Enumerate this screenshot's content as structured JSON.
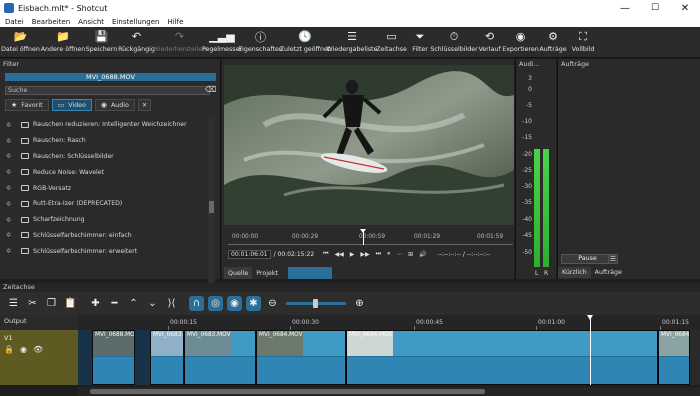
{
  "window": {
    "title": "Eisbach.mlt* - Shotcut",
    "min": "—",
    "max": "☐",
    "close": "✕"
  },
  "menu": [
    "Datei",
    "Bearbeiten",
    "Ansicht",
    "Einstellungen",
    "Hilfe"
  ],
  "toolbar": [
    {
      "label": "Datei öffnen",
      "icon": "folder-icon",
      "glyph": "📂",
      "enabled": true
    },
    {
      "label": "Andere öffnen",
      "icon": "open-other-icon",
      "glyph": "📁",
      "enabled": true
    },
    {
      "label": "Speichern",
      "icon": "save-icon",
      "glyph": "💾",
      "enabled": true
    },
    {
      "label": "Rückgängig",
      "icon": "undo-icon",
      "glyph": "↶",
      "enabled": true
    },
    {
      "label": "Wiederherstellen",
      "icon": "redo-icon",
      "glyph": "↷",
      "enabled": false
    },
    {
      "label": "Pegelmesser",
      "icon": "meter-icon",
      "glyph": "▁▃▅",
      "enabled": true
    },
    {
      "label": "Eigenschaften",
      "icon": "info-icon",
      "glyph": "ⓘ",
      "enabled": true
    },
    {
      "label": "Zuletzt geöffnet",
      "icon": "clock-icon",
      "glyph": "🕓",
      "enabled": true
    },
    {
      "label": "Wiedergabeliste",
      "icon": "playlist-icon",
      "glyph": "☰",
      "enabled": true
    },
    {
      "label": "Zeitachse",
      "icon": "timeline-icon",
      "glyph": "▭",
      "enabled": true
    },
    {
      "label": "Filter",
      "icon": "filter-icon",
      "glyph": "⏷",
      "enabled": true
    },
    {
      "label": "Schlüsselbilder",
      "icon": "stopwatch-icon",
      "glyph": "⏱",
      "enabled": true
    },
    {
      "label": "Verlauf",
      "icon": "history-icon",
      "glyph": "⟲",
      "enabled": true
    },
    {
      "label": "Exportieren",
      "icon": "export-icon",
      "glyph": "◉",
      "enabled": true
    },
    {
      "label": "Aufträge",
      "icon": "jobs-icon",
      "glyph": "⚙",
      "enabled": true
    },
    {
      "label": "Vollbild",
      "icon": "fullscreen-icon",
      "glyph": "⛶",
      "enabled": true
    }
  ],
  "filters": {
    "header": "Filter",
    "clip_name": "MVI_0688.MOV",
    "search_placeholder": "Suche",
    "tabs": [
      {
        "label": "Favorit",
        "icon": "star-icon",
        "glyph": "★",
        "active": false
      },
      {
        "label": "Video",
        "icon": "monitor-icon",
        "glyph": "▭",
        "active": true
      },
      {
        "label": "Audio",
        "icon": "speaker-icon",
        "glyph": "◉",
        "active": false
      }
    ],
    "close_glyph": "✕",
    "items": [
      "Rauschen reduzieren: Intelligenter Weichzeichner",
      "Rauschen: Rasch",
      "Rauschen: Schlüsselbilder",
      "Reduce Noise: Wavelet",
      "RGB-Versatz",
      "Rutt-Etra-Izer (DEPRECATED)",
      "Scharfzeichnung",
      "Schlüsselfarbschimmer: einfach",
      "Schlüsselfarbschimmer: erweitert"
    ]
  },
  "left_tabs": [
    {
      "label": "Eigenschaften",
      "active": false
    },
    {
      "label": "Wiedergabeliste",
      "active": false
    },
    {
      "label": "Filter",
      "active": true
    },
    {
      "label": "Exportieren",
      "active": false
    }
  ],
  "viewer": {
    "ruler_ticks": [
      "00:00:00",
      "00:00:29",
      "00:00:59",
      "00:01:29",
      "00:01:59"
    ],
    "current_tc": "00:01:06:01",
    "total_tc": "/ 00:02:15:22",
    "in_out": "--:--:--:-- / --:--:--:--",
    "tabs": [
      "Quelle",
      "Projekt"
    ],
    "transport_glyphs": [
      "⏮",
      "◀◀",
      "▶",
      "▶▶",
      "⏭",
      "⏸",
      "⋯",
      "⊞",
      "🔊"
    ]
  },
  "audio": {
    "header": "Audi...",
    "db_labels": [
      "3",
      "0",
      "-5",
      "-10",
      "-15",
      "-20",
      "-25",
      "-30",
      "-35",
      "-40",
      "-45",
      "-50"
    ],
    "channels": [
      "L",
      "R"
    ],
    "level_db": -18
  },
  "jobs": {
    "header": "Aufträge",
    "pause_label": "Pause",
    "menu_glyph": "☰",
    "tabs": [
      "Kürzlich",
      "Aufträge"
    ]
  },
  "timeline": {
    "header": "Zeitachse",
    "output_label": "Output",
    "track_name": "V1",
    "track_icons": [
      "🔒",
      "◉",
      "👁"
    ],
    "tools": [
      {
        "name": "menu-icon",
        "glyph": "☰"
      },
      {
        "name": "cut-icon",
        "glyph": "✂"
      },
      {
        "name": "copy-icon",
        "glyph": "❐"
      },
      {
        "name": "paste-icon",
        "glyph": "📋"
      },
      {
        "name": "append-icon",
        "glyph": "✚"
      },
      {
        "name": "remove-icon",
        "glyph": "━"
      },
      {
        "name": "lift-icon",
        "glyph": "⌃"
      },
      {
        "name": "overwrite-icon",
        "glyph": "⌄"
      },
      {
        "name": "split-icon",
        "glyph": "⟩⟨"
      },
      {
        "name": "snap-icon",
        "glyph": "∩"
      },
      {
        "name": "scrub-icon",
        "glyph": "◎"
      },
      {
        "name": "ripple-icon",
        "glyph": "◉"
      },
      {
        "name": "ripple-all-icon",
        "glyph": "✱"
      },
      {
        "name": "zoom-out-icon",
        "glyph": "⊖"
      },
      {
        "name": "zoom-in-icon",
        "glyph": "⊕"
      }
    ],
    "ruler": [
      "00:00:15",
      "00:00:30",
      "00:00:45",
      "00:01:00",
      "00:01:15"
    ],
    "clips": [
      {
        "label": "MVI_0688.MOV",
        "thumb": "#5c6b6b"
      },
      {
        "label": "MVI_0683.MOV",
        "thumb": "#8fb0c7"
      },
      {
        "label": "MVI_0683.MOV",
        "thumb": "#6e8c93"
      },
      {
        "label": "MVI_0684.MOV",
        "thumb": "#6b7a6b"
      },
      {
        "label": "MVI_0684.MOV",
        "thumb": "#cfd6d6"
      },
      {
        "label": "MVI_0684.MOV",
        "thumb": "#8aa3a3"
      }
    ]
  },
  "colors": {
    "accent": "#2a6f97",
    "meter": "#3cc23c",
    "track": "#5e5a22",
    "clip": "#3f9ac4"
  }
}
